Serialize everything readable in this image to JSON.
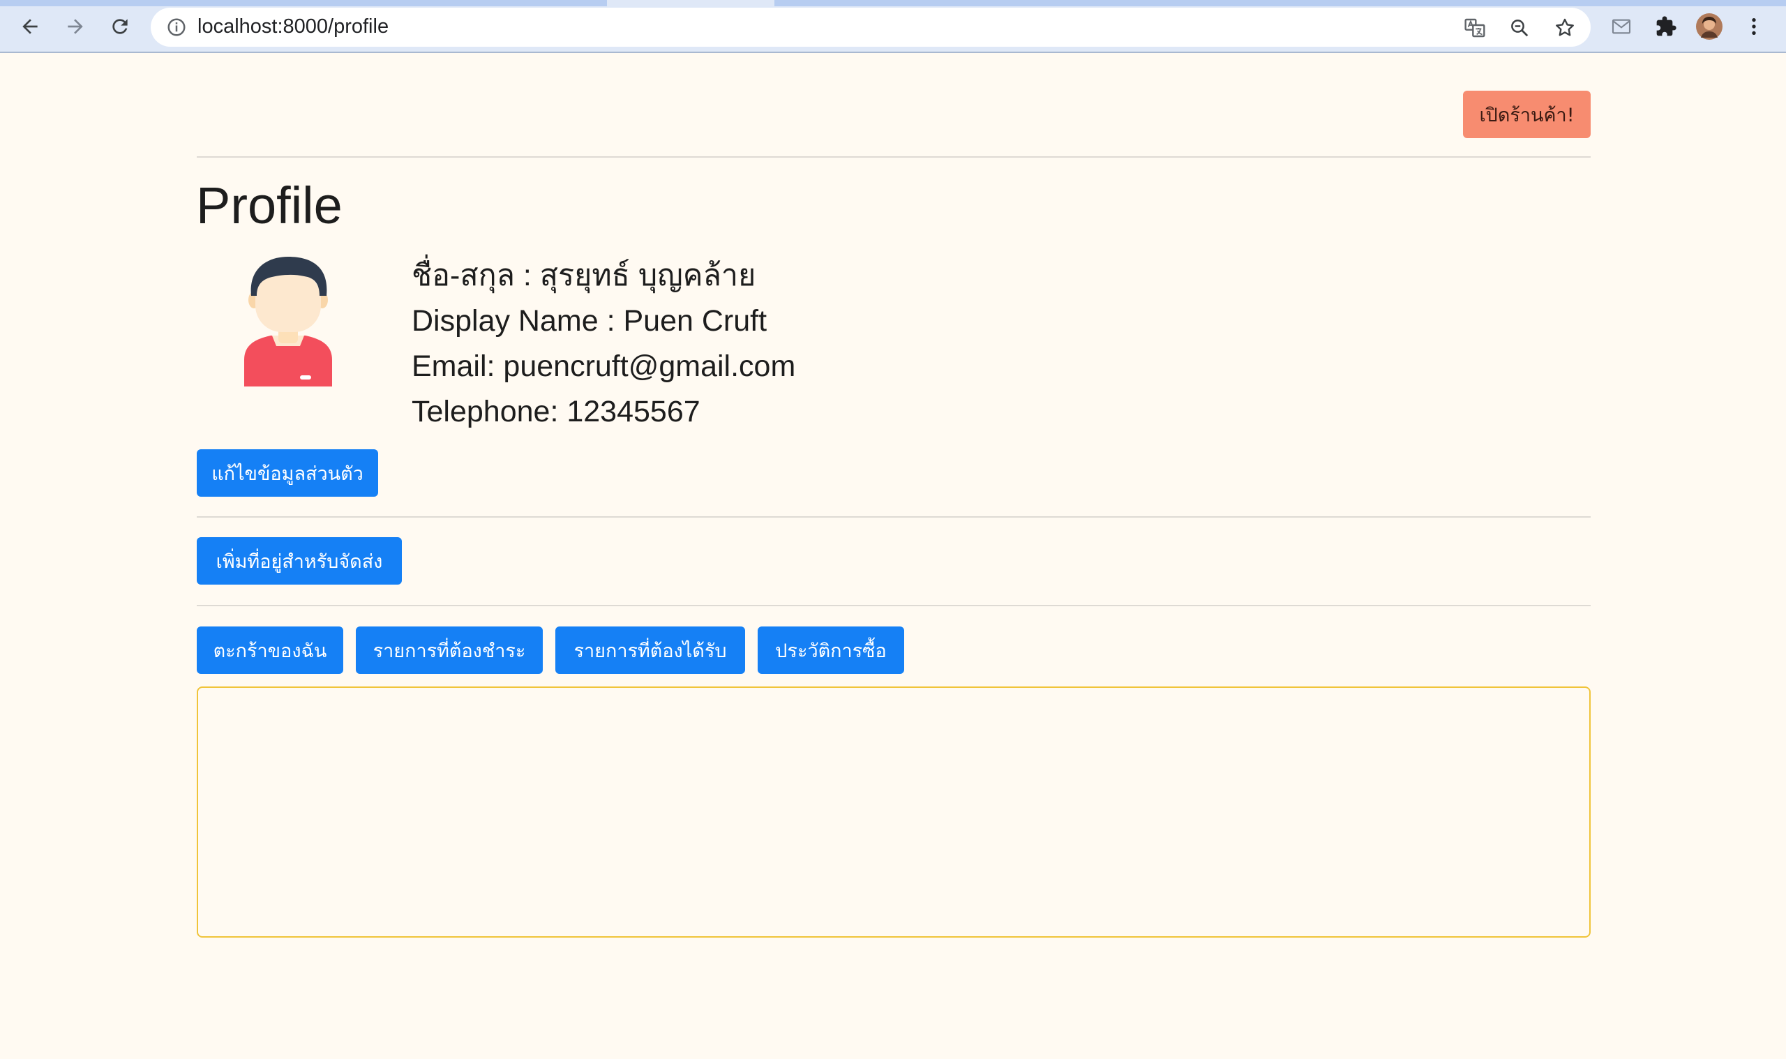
{
  "browser": {
    "url": "localhost:8000/profile"
  },
  "header": {
    "open_shop_label": "เปิดร้านค้า!"
  },
  "profile": {
    "title": "Profile",
    "fullname_line": "ชื่อ-สกุล : สุรยุทธ์ บุญคล้าย",
    "display_name_line": "Display Name : Puen Cruft",
    "email_line": "Email: puencruft@gmail.com",
    "telephone_line": "Telephone: 12345567",
    "edit_label": "แก้ไขข้อมูลส่วนตัว"
  },
  "address": {
    "add_label": "เพิ่มที่อยู่สำหรับจัดส่ง"
  },
  "tabs": [
    {
      "label": "ตะกร้าของฉัน"
    },
    {
      "label": "รายการที่ต้องชำระ"
    },
    {
      "label": "รายการที่ต้องได้รับ"
    },
    {
      "label": "ประวัติการซื้อ"
    }
  ],
  "colors": {
    "primary": "#1580f5",
    "shop_button": "#f78c70",
    "panel_border": "#f0c43a",
    "page_bg": "#fffaf2"
  }
}
